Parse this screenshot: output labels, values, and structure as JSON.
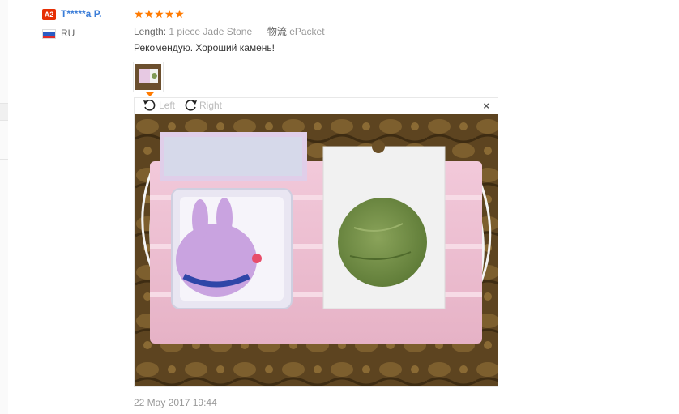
{
  "reviewer": {
    "level_badge": "A2",
    "name": "T*****a P.",
    "country": "RU"
  },
  "review": {
    "rating": 5,
    "stars": [
      "★",
      "★",
      "★",
      "★",
      "★"
    ],
    "length_label": "Length:",
    "length_value": "1 piece Jade Stone",
    "shipping_label": "物流",
    "shipping_value": "ePacket",
    "text": "Рекомендую. Хороший камень!",
    "date": "22 May 2017 19:44"
  },
  "viewer": {
    "rotate_left_label": "Left",
    "rotate_right_label": "Right",
    "close_label": "×"
  },
  "colors": {
    "username": "#3b7dd8",
    "badge": "#e62e04",
    "stars": "#ff7a00"
  }
}
